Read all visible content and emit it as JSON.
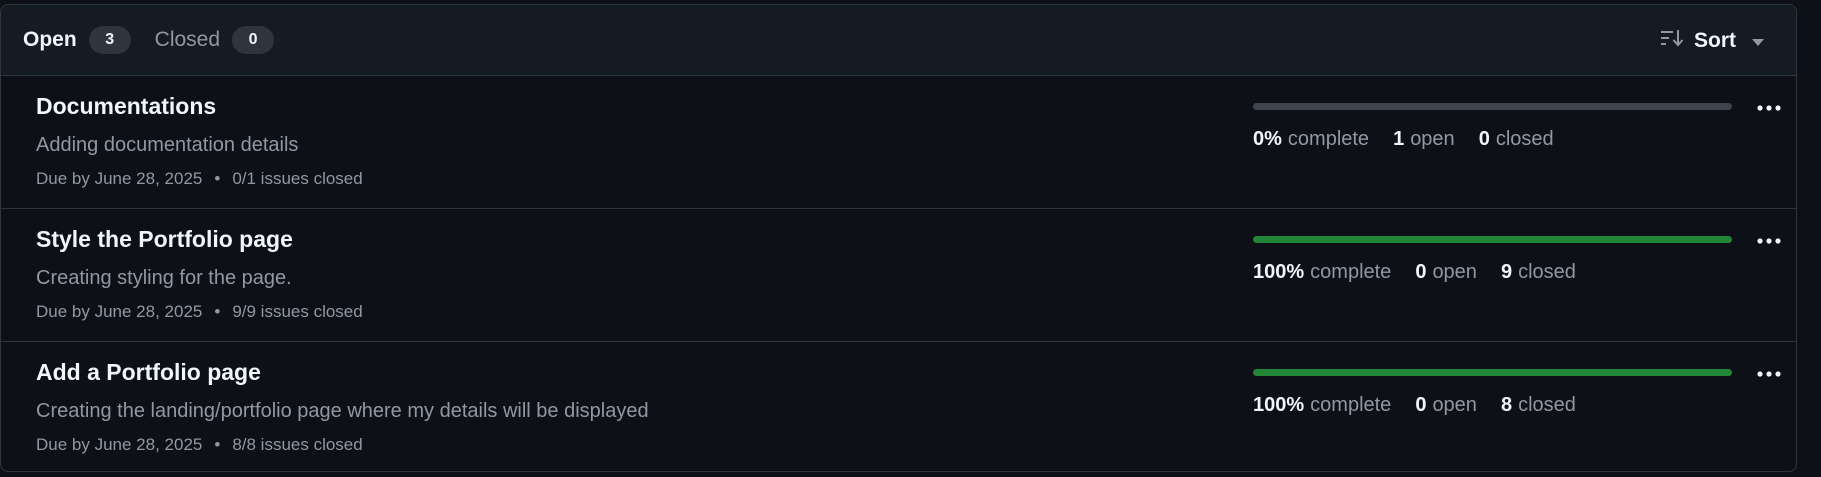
{
  "tabs": {
    "open_label": "Open",
    "open_count": "3",
    "closed_label": "Closed",
    "closed_count": "0"
  },
  "sort": {
    "label": "Sort",
    "icon": "sort-desc-icon",
    "caret_icon": "triangle-down-icon"
  },
  "colors": {
    "progress_fill": "#238636",
    "progress_track": "#3d444d"
  },
  "milestones": [
    {
      "title": "Documentations",
      "description": "Adding documentation details",
      "due": "Due by June 28, 2025",
      "separator": "•",
      "issues": "0/1 issues closed",
      "progress": 0,
      "percent": "0%",
      "complete_label": "complete",
      "open_count": "1",
      "open_label": "open",
      "closed_count": "0",
      "closed_label": "closed"
    },
    {
      "title": "Style the Portfolio page",
      "description": "Creating styling for the page.",
      "due": "Due by June 28, 2025",
      "separator": "•",
      "issues": "9/9 issues closed",
      "progress": 100,
      "percent": "100%",
      "complete_label": "complete",
      "open_count": "0",
      "open_label": "open",
      "closed_count": "9",
      "closed_label": "closed"
    },
    {
      "title": "Add a Portfolio page",
      "description": "Creating the landing/portfolio page where my details will be displayed",
      "due": "Due by June 28, 2025",
      "separator": "•",
      "issues": "8/8 issues closed",
      "progress": 100,
      "percent": "100%",
      "complete_label": "complete",
      "open_count": "0",
      "open_label": "open",
      "closed_count": "8",
      "closed_label": "closed"
    }
  ]
}
